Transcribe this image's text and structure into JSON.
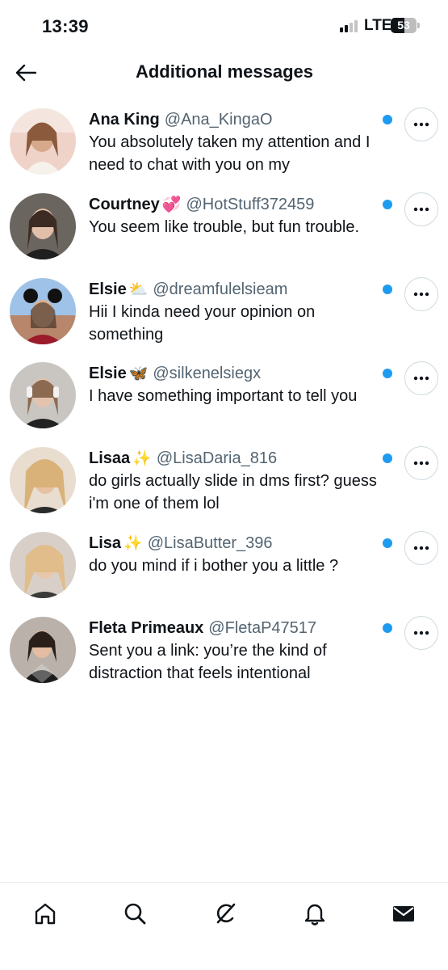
{
  "status_bar": {
    "time": "13:39",
    "network": "LTE",
    "battery_level": "53"
  },
  "header": {
    "title": "Additional messages"
  },
  "messages": [
    {
      "name": "Ana King",
      "emoji": "",
      "handle": "@Ana_KingaO",
      "preview": "You absolutely taken my attention and I need to chat with you on my",
      "unread": true
    },
    {
      "name": "Courtney",
      "emoji": "💞",
      "handle": "@HotStuff372459",
      "preview": "You seem like trouble, but fun trouble.",
      "unread": true
    },
    {
      "name": "Elsie",
      "emoji": "⛅",
      "handle": "@dreamfulelsieam",
      "preview": "Hii I kinda need your opinion on something",
      "unread": true
    },
    {
      "name": "Elsie",
      "emoji": "🦋",
      "handle": "@silkenelsiegx",
      "preview": "I have something important to tell you",
      "unread": true
    },
    {
      "name": "Lisaa",
      "emoji": "✨",
      "handle": "@LisaDaria_816",
      "preview": "do girls actually slide in dms first? guess i'm one of them lol",
      "unread": true
    },
    {
      "name": "Lisa",
      "emoji": "✨",
      "handle": "@LisaButter_396",
      "preview": "do you mind if i bother you a little ?",
      "unread": true
    },
    {
      "name": "Fleta Primeaux",
      "emoji": "",
      "handle": "@FletaP47517",
      "preview": "Sent you a link: you’re the kind of distraction that feels intentional",
      "unread": true
    }
  ],
  "tab_bar": {
    "tabs": [
      {
        "name": "home",
        "icon": "home-icon"
      },
      {
        "name": "search",
        "icon": "search-icon"
      },
      {
        "name": "grok",
        "icon": "grok-icon"
      },
      {
        "name": "notifications",
        "icon": "bell-icon"
      },
      {
        "name": "messages",
        "icon": "envelope-icon",
        "active": true
      }
    ]
  },
  "colors": {
    "accent": "#1d9bf0",
    "secondary_text": "#536471",
    "primary_text": "#0f1419"
  }
}
